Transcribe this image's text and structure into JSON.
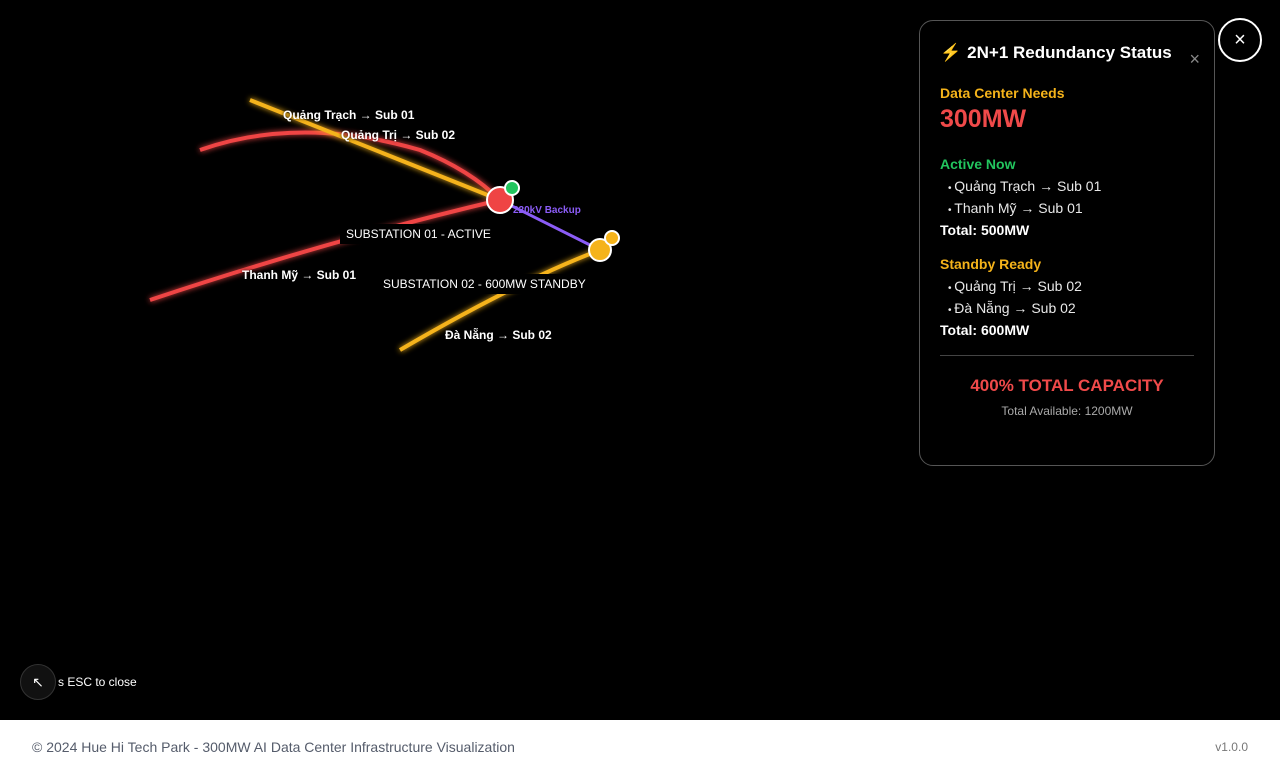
{
  "map": {
    "lines": [
      {
        "name": "Quảng Trạch → Sub 01",
        "color": "#f5b31a"
      },
      {
        "name": "Quảng Trị → Sub 02",
        "color": "#ef4444"
      },
      {
        "name": "Thanh Mỹ → Sub 01",
        "color": "#ef4444"
      },
      {
        "name": "Đà Nẵng → Sub 02",
        "color": "#f5b31a"
      }
    ],
    "labels": {
      "quang_trach": "Quảng Trạch → Sub 01",
      "quang_tri": "Quảng Trị → Sub 02",
      "thanh_my": "Thanh Mỹ → Sub 01",
      "da_nang": "Đà Nẵng → Sub 02",
      "sub01": "SUBSTATION 01 - ACTIVE",
      "sub02": "SUBSTATION 02 - 600MW STANDBY",
      "backup": "220kV Backup"
    },
    "colors": {
      "active": "#ef4444",
      "standby": "#f5b31a",
      "backup": "#8b5cf6",
      "ok": "#22c55e"
    }
  },
  "panel": {
    "icon": "⚡",
    "title": "2N+1 Redundancy Status",
    "close": "×",
    "needs_label": "Data Center Needs",
    "needs_value": "300MW",
    "active_label": "Active Now",
    "active_items": [
      "Quảng Trạch → Sub 01",
      "Thanh Mỹ → Sub 01"
    ],
    "active_total": "Total: 500MW",
    "standby_label": "Standby Ready",
    "standby_items": [
      "Quảng Trị → Sub 02",
      "Đà Nẵng → Sub 02"
    ],
    "standby_total": "Total: 600MW",
    "capacity": "400% TOTAL CAPACITY",
    "available": "Total Available: 1200MW"
  },
  "close_button": "×",
  "esc": {
    "icon": "↖",
    "text": "s ESC to close"
  },
  "footer": {
    "left": "© 2024 Hue Hi Tech Park - 300MW AI Data Center Infrastructure Visualization",
    "right": "v1.0.0"
  }
}
